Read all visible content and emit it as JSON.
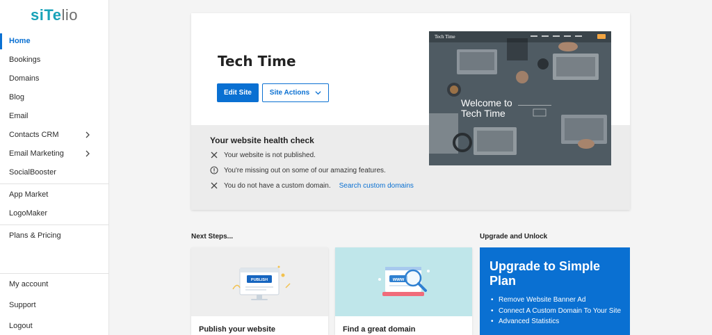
{
  "brand": {
    "part1": "siTe",
    "part2": "lio"
  },
  "sidebar": {
    "items": [
      {
        "label": "Home",
        "active": true
      },
      {
        "label": "Bookings"
      },
      {
        "label": "Domains"
      },
      {
        "label": "Blog"
      },
      {
        "label": "Email"
      },
      {
        "label": "Contacts CRM",
        "expandable": true
      },
      {
        "label": "Email Marketing",
        "expandable": true
      },
      {
        "label": "SocialBooster"
      }
    ],
    "apps": [
      {
        "label": "App Market"
      },
      {
        "label": "LogoMaker"
      }
    ],
    "plans": {
      "label": "Plans & Pricing"
    },
    "bottom": [
      {
        "label": "My account"
      },
      {
        "label": "Support"
      },
      {
        "label": "Logout"
      }
    ]
  },
  "site": {
    "title": "Tech Time",
    "edit_label": "Edit Site",
    "actions_label": "Site Actions"
  },
  "health": {
    "title": "Your website health check",
    "items": [
      {
        "icon": "x-icon",
        "text": "Your website is not published."
      },
      {
        "icon": "alert-circle-icon",
        "text": "You're missing out on some of our amazing features."
      },
      {
        "icon": "x-icon",
        "text": "You do not have a custom domain.",
        "link": "Search custom domains"
      }
    ]
  },
  "preview": {
    "brand": "Tech Time",
    "welcome_line1": "Welcome to",
    "welcome_line2": "Tech Time"
  },
  "illustrations": {
    "publish_label": "PUBLISH",
    "domain_label": "www"
  },
  "next_steps": {
    "heading": "Next Steps...",
    "cards": [
      {
        "title": "Publish your website"
      },
      {
        "title": "Find a great domain"
      }
    ]
  },
  "upgrade": {
    "heading": "Upgrade and Unlock",
    "title": "Upgrade to Simple Plan",
    "features": [
      "Remove Website Banner Ad",
      "Connect A Custom Domain To Your Site",
      "Advanced Statistics"
    ]
  },
  "colors": {
    "accent": "#0a70d2",
    "logo_teal": "#17a2b8",
    "domain_card_bg": "#bfe6ea"
  }
}
